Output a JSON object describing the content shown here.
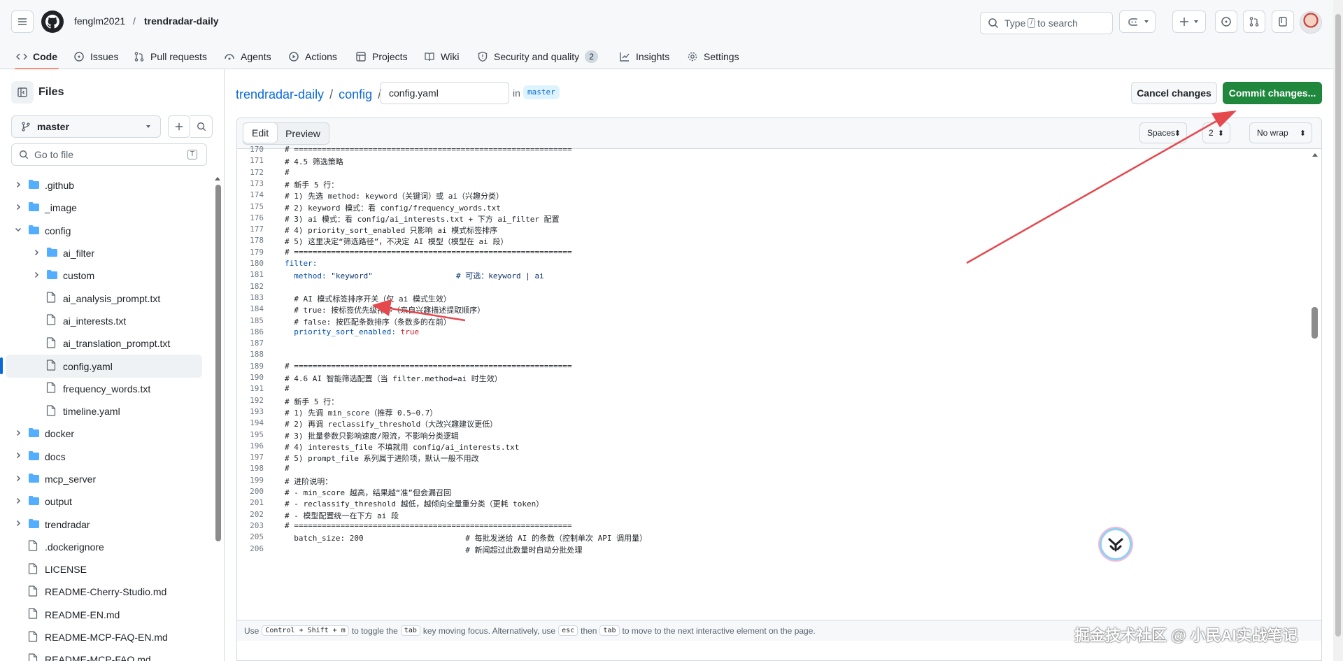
{
  "header": {
    "owner": "fenglm2021",
    "separator": "/",
    "repo": "trendradar-daily",
    "search_prefix": "Type",
    "search_key": "/",
    "search_suffix": "to search"
  },
  "tabs": [
    {
      "label": "Code",
      "icon": "code-icon"
    },
    {
      "label": "Issues",
      "icon": "issue-icon"
    },
    {
      "label": "Pull requests",
      "icon": "pr-icon"
    },
    {
      "label": "Agents",
      "icon": "agent-icon"
    },
    {
      "label": "Actions",
      "icon": "play-icon"
    },
    {
      "label": "Projects",
      "icon": "table-icon"
    },
    {
      "label": "Wiki",
      "icon": "book-icon"
    },
    {
      "label": "Security and quality",
      "icon": "shield-icon",
      "count": "2"
    },
    {
      "label": "Insights",
      "icon": "graph-icon"
    },
    {
      "label": "Settings",
      "icon": "gear-icon"
    }
  ],
  "sidebar": {
    "title": "Files",
    "branch": "master",
    "goto_placeholder": "Go to file",
    "goto_key": "T",
    "items": [
      {
        "label": ".github",
        "type": "folder",
        "depth": 0,
        "expanded": false
      },
      {
        "label": "_image",
        "type": "folder",
        "depth": 0,
        "expanded": false
      },
      {
        "label": "config",
        "type": "folder",
        "depth": 0,
        "expanded": true
      },
      {
        "label": "ai_filter",
        "type": "folder",
        "depth": 1,
        "expanded": false
      },
      {
        "label": "custom",
        "type": "folder",
        "depth": 1,
        "expanded": false
      },
      {
        "label": "ai_analysis_prompt.txt",
        "type": "file",
        "depth": 1
      },
      {
        "label": "ai_interests.txt",
        "type": "file",
        "depth": 1
      },
      {
        "label": "ai_translation_prompt.txt",
        "type": "file",
        "depth": 1
      },
      {
        "label": "config.yaml",
        "type": "file",
        "depth": 1,
        "selected": true
      },
      {
        "label": "frequency_words.txt",
        "type": "file",
        "depth": 1
      },
      {
        "label": "timeline.yaml",
        "type": "file",
        "depth": 1
      },
      {
        "label": "docker",
        "type": "folder",
        "depth": 0,
        "expanded": false
      },
      {
        "label": "docs",
        "type": "folder",
        "depth": 0,
        "expanded": false
      },
      {
        "label": "mcp_server",
        "type": "folder",
        "depth": 0,
        "expanded": false
      },
      {
        "label": "output",
        "type": "folder",
        "depth": 0,
        "expanded": false
      },
      {
        "label": "trendradar",
        "type": "folder",
        "depth": 0,
        "expanded": false
      },
      {
        "label": ".dockerignore",
        "type": "file",
        "depth": 0
      },
      {
        "label": "LICENSE",
        "type": "file",
        "depth": 0
      },
      {
        "label": "README-Cherry-Studio.md",
        "type": "file",
        "depth": 0
      },
      {
        "label": "README-EN.md",
        "type": "file",
        "depth": 0
      },
      {
        "label": "README-MCP-FAQ-EN.md",
        "type": "file",
        "depth": 0
      },
      {
        "label": "README-MCP-FAQ.md",
        "type": "file",
        "depth": 0
      }
    ]
  },
  "editor_header": {
    "repo_link": "trendradar-daily",
    "dir_link": "config",
    "sep": "/",
    "filename": "config.yaml",
    "in_label": "in",
    "branch": "master",
    "cancel_label": "Cancel changes",
    "commit_label": "Commit changes..."
  },
  "editor_toolbar": {
    "edit_tab": "Edit",
    "preview_tab": "Preview",
    "indent_mode": "Spaces",
    "indent_size": "2",
    "wrap_mode": "No wrap"
  },
  "code_lines": [
    {
      "n": "170",
      "t": "# ============================================================"
    },
    {
      "n": "171",
      "t": "# 4.5 筛选策略"
    },
    {
      "n": "172",
      "t": "#"
    },
    {
      "n": "173",
      "t": "# 新手 5 行："
    },
    {
      "n": "174",
      "t": "# 1) 先选 method: keyword（关键词）或 ai（兴趣分类）"
    },
    {
      "n": "175",
      "t": "# 2) keyword 模式：看 config/frequency_words.txt"
    },
    {
      "n": "176",
      "t": "# 3) ai 模式：看 config/ai_interests.txt + 下方 ai_filter 配置"
    },
    {
      "n": "177",
      "t": "# 4) priority_sort_enabled 只影响 ai 模式标签排序"
    },
    {
      "n": "178",
      "t": "# 5) 这里决定“筛选路径”，不决定 AI 模型（模型在 ai 段）"
    },
    {
      "n": "179",
      "t": "# ============================================================"
    },
    {
      "n": "180",
      "t": "filter:",
      "kind": "key"
    },
    {
      "n": "181",
      "t": "  method: \"keyword\"                  # 可选：keyword | ai",
      "kind": "method"
    },
    {
      "n": "182",
      "t": ""
    },
    {
      "n": "183",
      "t": "  # AI 模式标签排序开关（仅 ai 模式生效）"
    },
    {
      "n": "184",
      "t": "  # true: 按标签优先级排序（来自兴趣描述提取顺序）"
    },
    {
      "n": "185",
      "t": "  # false: 按匹配条数排序（条数多的在前）"
    },
    {
      "n": "186",
      "t": "  priority_sort_enabled: true",
      "kind": "bool"
    },
    {
      "n": "187",
      "t": ""
    },
    {
      "n": "188",
      "t": ""
    },
    {
      "n": "189",
      "t": "# ============================================================"
    },
    {
      "n": "190",
      "t": "# 4.6 AI 智能筛选配置（当 filter.method=ai 时生效）"
    },
    {
      "n": "191",
      "t": "#"
    },
    {
      "n": "192",
      "t": "# 新手 5 行："
    },
    {
      "n": "193",
      "t": "# 1) 先调 min_score（推荐 0.5~0.7）"
    },
    {
      "n": "194",
      "t": "# 2) 再调 reclassify_threshold（大改兴趣建议更低）"
    },
    {
      "n": "195",
      "t": "# 3) 批量参数只影响速度/限流，不影响分类逻辑"
    },
    {
      "n": "196",
      "t": "# 4) interests_file 不填就用 config/ai_interests.txt"
    },
    {
      "n": "197",
      "t": "# 5) prompt_file 系列属于进阶项，默认一般不用改"
    },
    {
      "n": "198",
      "t": "#"
    },
    {
      "n": "199",
      "t": "# 进阶说明："
    },
    {
      "n": "200",
      "t": "# - min_score 越高，结果越“准”但会漏召回"
    },
    {
      "n": "201",
      "t": "# - reclassify_threshold 越低，越倾向全量重分类（更耗 token）"
    },
    {
      "n": "202",
      "t": "# - 模型配置统一在下方 ai 段"
    },
    {
      "n": "203",
      "t": "# ============================================================"
    },
    {
      "n": "205",
      "t": "  batch_size: 200                      # 每批发送给 AI 的条数（控制单次 API 调用量）"
    },
    {
      "n": "206",
      "t": "                                       # 新闻超过此数量时自动分批处理"
    }
  ],
  "hint": {
    "use": "Use",
    "keys": "Control + Shift + m",
    "mid1": "to toggle the",
    "tab_key": "tab",
    "mid2": "key moving focus. Alternatively, use",
    "esc_key": "esc",
    "then": "then",
    "tab_key2": "tab",
    "end": "to move to the next interactive element on the page."
  },
  "watermark": "掘金技术社区 @ 小民AI实战笔记",
  "colors": {
    "accent": "#0969da",
    "commit_green": "#1f883d",
    "tab_underline": "#fd8c73",
    "annotation_arrow": "#e5484d"
  }
}
